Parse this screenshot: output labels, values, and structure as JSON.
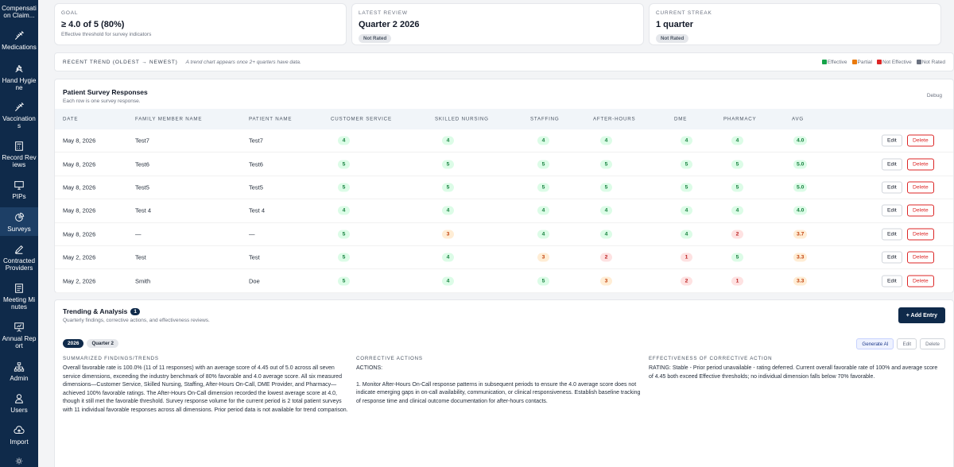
{
  "colors": {
    "sidebar": "#0f2a4a",
    "effective": "#16a34a",
    "partial": "#ea7a0c",
    "not_effective": "#dc2626",
    "not_rated": "#6b7280"
  },
  "sidebar": {
    "items": [
      {
        "label": "Compensati on Claim...",
        "icon": "clipboard-icon",
        "active": false
      },
      {
        "label": "Medications",
        "icon": "syringe-icon",
        "active": false
      },
      {
        "label": "Hand Hygiene",
        "icon": "hands-wash-icon",
        "active": false
      },
      {
        "label": "Vaccination s",
        "icon": "syringe-icon",
        "active": false
      },
      {
        "label": "Record Reviews",
        "icon": "calculator-icon",
        "active": false
      },
      {
        "label": "PIPs",
        "icon": "monitor-icon",
        "active": false
      },
      {
        "label": "Surveys",
        "icon": "pie-chart-icon",
        "active": true
      },
      {
        "label": "Contracted Providers",
        "icon": "pen-icon",
        "active": false
      },
      {
        "label": "Meeting Minutes",
        "icon": "notebook-icon",
        "active": false
      },
      {
        "label": "Annual Report",
        "icon": "presentation-icon",
        "active": false
      },
      {
        "label": "Admin",
        "icon": "org-chart-icon",
        "active": false
      },
      {
        "label": "Users",
        "icon": "user-icon",
        "active": false
      },
      {
        "label": "Import",
        "icon": "cloud-upload-icon",
        "active": false
      },
      {
        "label": "",
        "icon": "gear-icon",
        "active": false
      }
    ]
  },
  "stats": {
    "goal": {
      "label": "GOAL",
      "value": "≥ 4.0 of 5 (80%)",
      "sub": "Effective threshold for survey indicators"
    },
    "latest_review": {
      "label": "LATEST REVIEW",
      "value": "Quarter 2 2026",
      "badge": "Not Rated"
    },
    "streak": {
      "label": "CURRENT STREAK",
      "value": "1 quarter",
      "badge": "Not Rated"
    }
  },
  "trend": {
    "title": "RECENT TREND (OLDEST → NEWEST)",
    "note": "A trend chart appears once 2+ quarters have data.",
    "legend": [
      "Effective",
      "Partial",
      "Not Effective",
      "Not Rated"
    ]
  },
  "survey": {
    "title": "Patient Survey Responses",
    "subtitle": "Each row is one survey response.",
    "debug_label": "Debug",
    "columns": [
      "DATE",
      "FAMILY MEMBER NAME",
      "PATIENT NAME",
      "CUSTOMER SERVICE",
      "SKILLED NURSING",
      "STAFFING",
      "AFTER-HOURS",
      "DME",
      "PHARMACY",
      "AVG"
    ],
    "edit_label": "Edit",
    "delete_label": "Delete",
    "rows": [
      {
        "date": "May 8, 2026",
        "family": "Test7",
        "patient": "Test7",
        "scores": [
          "4",
          "4",
          "4",
          "4",
          "4",
          "4"
        ],
        "avg": "4.0"
      },
      {
        "date": "May 8, 2026",
        "family": "Test6",
        "patient": "Test6",
        "scores": [
          "5",
          "5",
          "5",
          "5",
          "5",
          "5"
        ],
        "avg": "5.0"
      },
      {
        "date": "May 8, 2026",
        "family": "Test5",
        "patient": "Test5",
        "scores": [
          "5",
          "5",
          "5",
          "5",
          "5",
          "5"
        ],
        "avg": "5.0"
      },
      {
        "date": "May 8, 2026",
        "family": "Test 4",
        "patient": "Test 4",
        "scores": [
          "4",
          "4",
          "4",
          "4",
          "4",
          "4"
        ],
        "avg": "4.0"
      },
      {
        "date": "May 8, 2026",
        "family": "—",
        "patient": "—",
        "scores": [
          "5",
          "3",
          "4",
          "4",
          "4",
          "2"
        ],
        "avg": "3.7"
      },
      {
        "date": "May 2, 2026",
        "family": "Test",
        "patient": "Test",
        "scores": [
          "5",
          "4",
          "3",
          "2",
          "1",
          "5"
        ],
        "avg": "3.3"
      },
      {
        "date": "May 2, 2026",
        "family": "Smith",
        "patient": "Doe",
        "scores": [
          "5",
          "4",
          "5",
          "3",
          "2",
          "1"
        ],
        "avg": "3.3"
      }
    ]
  },
  "analysis": {
    "title": "Trending & Analysis",
    "count": "1",
    "subtitle": "Quarterly findings, corrective actions, and effectiveness reviews.",
    "add_label": "+ Add Entry",
    "year": "2026",
    "quarter": "Quarter 2",
    "generate_label": "Generate AI",
    "edit_label": "Edit",
    "delete_label": "Delete",
    "findings_title": "SUMMARIZED FINDINGS/TRENDS",
    "findings_text": "Overall favorable rate is 100.0% (11 of 11 responses) with an average score of 4.45 out of 5.0 across all seven service dimensions, exceeding the industry benchmark of 80% favorable and 4.0 average score. All six measured dimensions—Customer Service, Skilled Nursing, Staffing, After-Hours On-Call, DME Provider, and Pharmacy—achieved 100% favorable ratings. The After-Hours On-Call dimension recorded the lowest average score at 4.0, though it still met the favorable threshold. Survey response volume for the current period is 2 total patient surveys with 11 individual favorable responses across all dimensions. Prior period data is not available for trend comparison.",
    "actions_title": "CORRECTIVE ACTIONS",
    "actions_heading": "ACTIONS:",
    "actions_text": "1. Monitor After-Hours On-Call response patterns in subsequent periods to ensure the 4.0 average score does not indicate emerging gaps in on-call availability, communication, or clinical responsiveness. Establish baseline tracking of response time and clinical outcome documentation for after-hours contacts.",
    "effectiveness_title": "EFFECTIVENESS OF CORRECTIVE ACTION",
    "effectiveness_text": "RATING: Stable - Prior period unavailable - rating deferred. Current overall favorable rate of 100% and average score of 4.45 both exceed Effective thresholds; no individual dimension falls below 70% favorable."
  }
}
